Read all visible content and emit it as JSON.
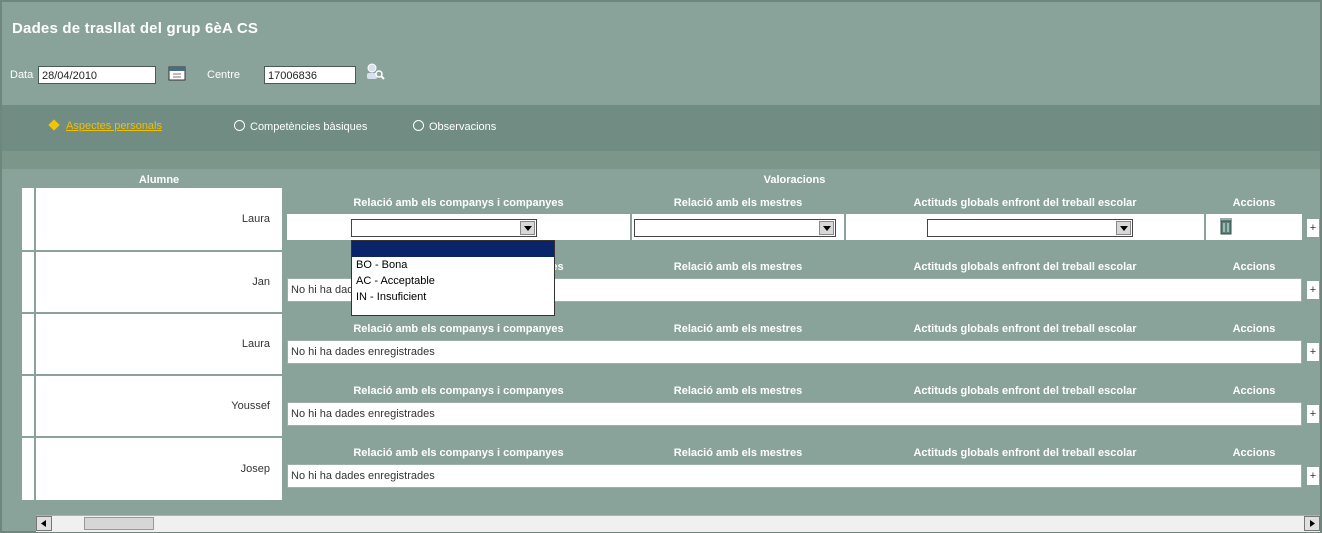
{
  "title": "Dades de trasllat del grup 6èA CS",
  "filters": {
    "date_label": "Data",
    "date_value": "28/04/2010",
    "center_label": "Centre",
    "center_value": "17006836"
  },
  "tabs": [
    {
      "label": "Aspectes personals",
      "active": true
    },
    {
      "label": "Competències bàsiques",
      "active": false
    },
    {
      "label": "Observacions",
      "active": false
    }
  ],
  "grid": {
    "col_alumne": "Alumne",
    "col_valoracions": "Valoracions",
    "subheaders": {
      "rel_companys": "Relació amb els companys i companyes",
      "rel_mestres": "Relació amb els mestres",
      "actituds": "Actituds globals enfront del treball escolar",
      "accions": "Accions"
    },
    "students": [
      {
        "name": "Laura"
      },
      {
        "name": "Jan"
      },
      {
        "name": "Laura"
      },
      {
        "name": "Youssef"
      },
      {
        "name": "Josep"
      }
    ],
    "empty_message": "No hi ha dades enregistrades",
    "plus": "+"
  },
  "dropdown": {
    "options": [
      "BO - Bona",
      "AC - Acceptable",
      "IN - Insuficient"
    ]
  },
  "icons": {
    "calendar": "calendar-icon",
    "search": "search-person-icon",
    "delete": "trash-icon"
  }
}
